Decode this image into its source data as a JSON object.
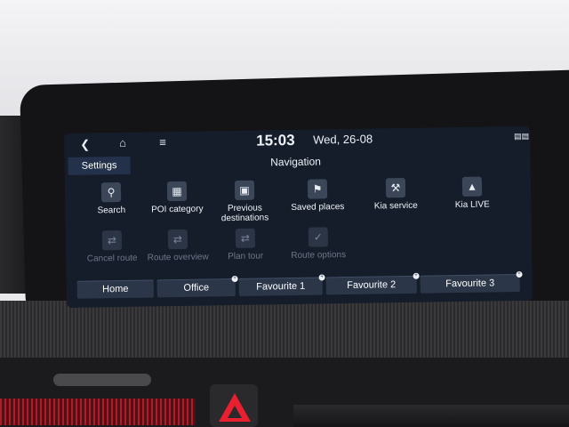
{
  "status": {
    "back_icon": "back-arrow-icon",
    "home_icon": "home-icon",
    "menu_icon": "menu-icon",
    "time": "15:03",
    "date": "Wed, 26-08",
    "signal_icon": "signal-icon"
  },
  "header": {
    "settings": "Settings",
    "title": "Navigation"
  },
  "grid_row1": [
    {
      "label": "Search",
      "icon": "search-icon"
    },
    {
      "label": "POI category",
      "icon": "poi-category-icon"
    },
    {
      "label": "Previous\ndestinations",
      "label_line1": "Previous",
      "label_line2": "destinations",
      "icon": "previous-destinations-icon"
    },
    {
      "label": "Saved places",
      "icon": "saved-places-icon"
    },
    {
      "label": "Kia service",
      "icon": "kia-service-icon"
    },
    {
      "label": "Kia LIVE",
      "icon": "kia-live-icon"
    }
  ],
  "grid_row2": [
    {
      "label": "Cancel route",
      "icon": "cancel-route-icon",
      "enabled": false
    },
    {
      "label": "Route overview",
      "icon": "route-overview-icon",
      "enabled": false
    },
    {
      "label": "Plan tour",
      "icon": "plan-tour-icon",
      "enabled": false
    },
    {
      "label": "Route options",
      "icon": "route-options-icon",
      "enabled": false
    }
  ],
  "bottom_buttons": [
    {
      "label": "Home"
    },
    {
      "label": "Office"
    },
    {
      "label": "Favourite 1"
    },
    {
      "label": "Favourite 2"
    },
    {
      "label": "Favourite 3"
    }
  ]
}
